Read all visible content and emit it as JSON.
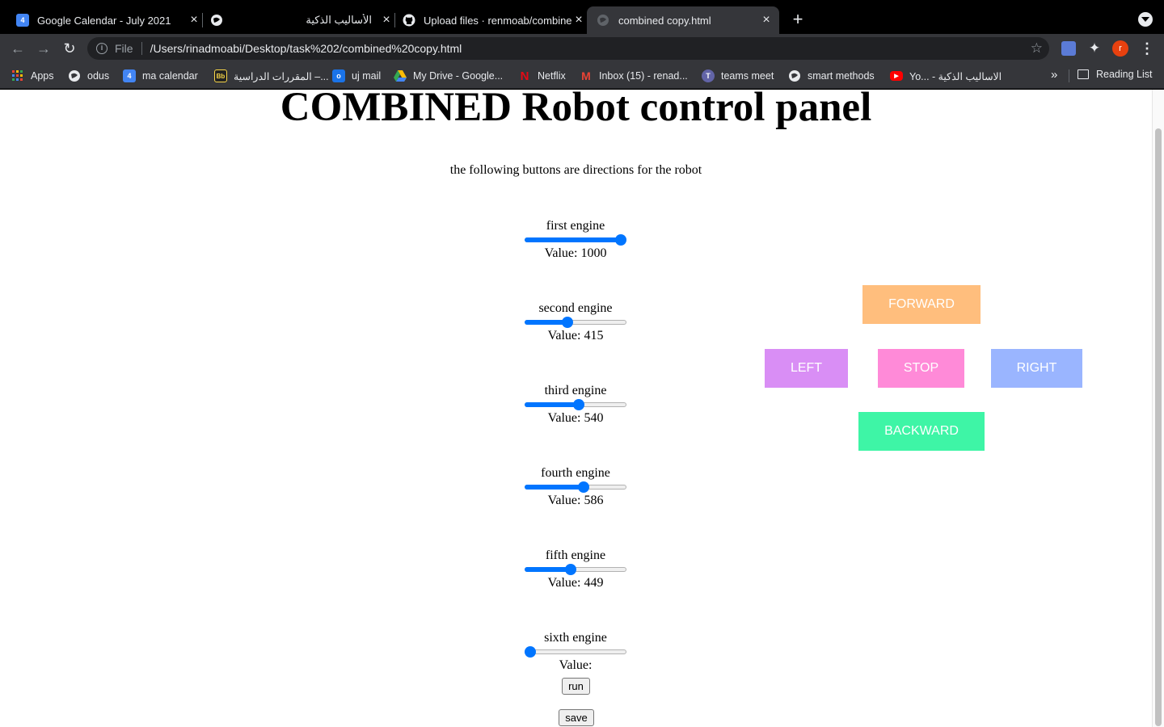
{
  "browser": {
    "tabs": [
      {
        "title": "Google Calendar - July 2021",
        "favicon": "calendar-icon",
        "favicon_color": "#4285f4",
        "favicon_text": "4"
      },
      {
        "title": "الأساليب الذكية",
        "favicon": "globe-icon",
        "favicon_color": "#e8eaed",
        "favicon_text": ""
      },
      {
        "title": "Upload files · renmoab/combined",
        "favicon": "github-icon",
        "favicon_color": "#e8eaed",
        "favicon_text": ""
      },
      {
        "title": "combined copy.html",
        "favicon": "globe-icon",
        "favicon_color": "#5f6368",
        "favicon_text": "",
        "active": true
      }
    ],
    "address": {
      "scheme": "File",
      "url": "/Users/rinadmoabi/Desktop/task%202/combined%20copy.html"
    },
    "profile_initial": "r",
    "bookmarks": [
      {
        "label": "Apps",
        "icon": "apps-grid-icon",
        "color": "#ea4335"
      },
      {
        "label": "odus",
        "icon": "globe-icon",
        "color": "#e8eaed"
      },
      {
        "label": "ma calendar",
        "icon": "calendar-icon",
        "color": "#4285f4"
      },
      {
        "label": "المقررات الدراسية –...",
        "icon": "blackboard-icon",
        "color": "#f9d648"
      },
      {
        "label": "uj mail",
        "icon": "outlook-icon",
        "color": "#1a73e8"
      },
      {
        "label": "My Drive - Google...",
        "icon": "drive-icon",
        "color": "#34a853"
      },
      {
        "label": "Netflix",
        "icon": "netflix-icon",
        "color": "#e50914"
      },
      {
        "label": "Inbox (15) - renad...",
        "icon": "gmail-icon",
        "color": "#ea4335"
      },
      {
        "label": "teams meet",
        "icon": "teams-icon",
        "color": "#6264a7"
      },
      {
        "label": "smart methods",
        "icon": "globe-icon",
        "color": "#e8eaed"
      },
      {
        "label": "Yo... - الاساليب الذكية",
        "icon": "youtube-icon",
        "color": "#ff0000"
      }
    ],
    "reading_list": "Reading List"
  },
  "page": {
    "title": "COMBINED Robot control panel",
    "subtitle": "the following buttons are directions for the robot",
    "engines": [
      {
        "label": "first engine",
        "value_text": "Value: 1000",
        "level": 1.0
      },
      {
        "label": "second engine",
        "value_text": "Value: 415",
        "level": 0.415
      },
      {
        "label": "third engine",
        "value_text": "Value: 540",
        "level": 0.54
      },
      {
        "label": "fourth engine",
        "value_text": "Value: 586",
        "level": 0.586
      },
      {
        "label": "fifth engine",
        "value_text": "Value: 449",
        "level": 0.449
      },
      {
        "label": "sixth engine",
        "value_text": "Value:",
        "level": 0.0
      }
    ],
    "run_label": "run",
    "save_label": "save",
    "directions": {
      "forward": {
        "label": "FORWARD",
        "color": "#ffbe7d"
      },
      "left": {
        "label": "LEFT",
        "color": "#d98ef5"
      },
      "stop": {
        "label": "STOP",
        "color": "#ff8ad8"
      },
      "right": {
        "label": "RIGHT",
        "color": "#9ab5ff"
      },
      "backward": {
        "label": "BACKWARD",
        "color": "#3ef5a6"
      }
    }
  }
}
